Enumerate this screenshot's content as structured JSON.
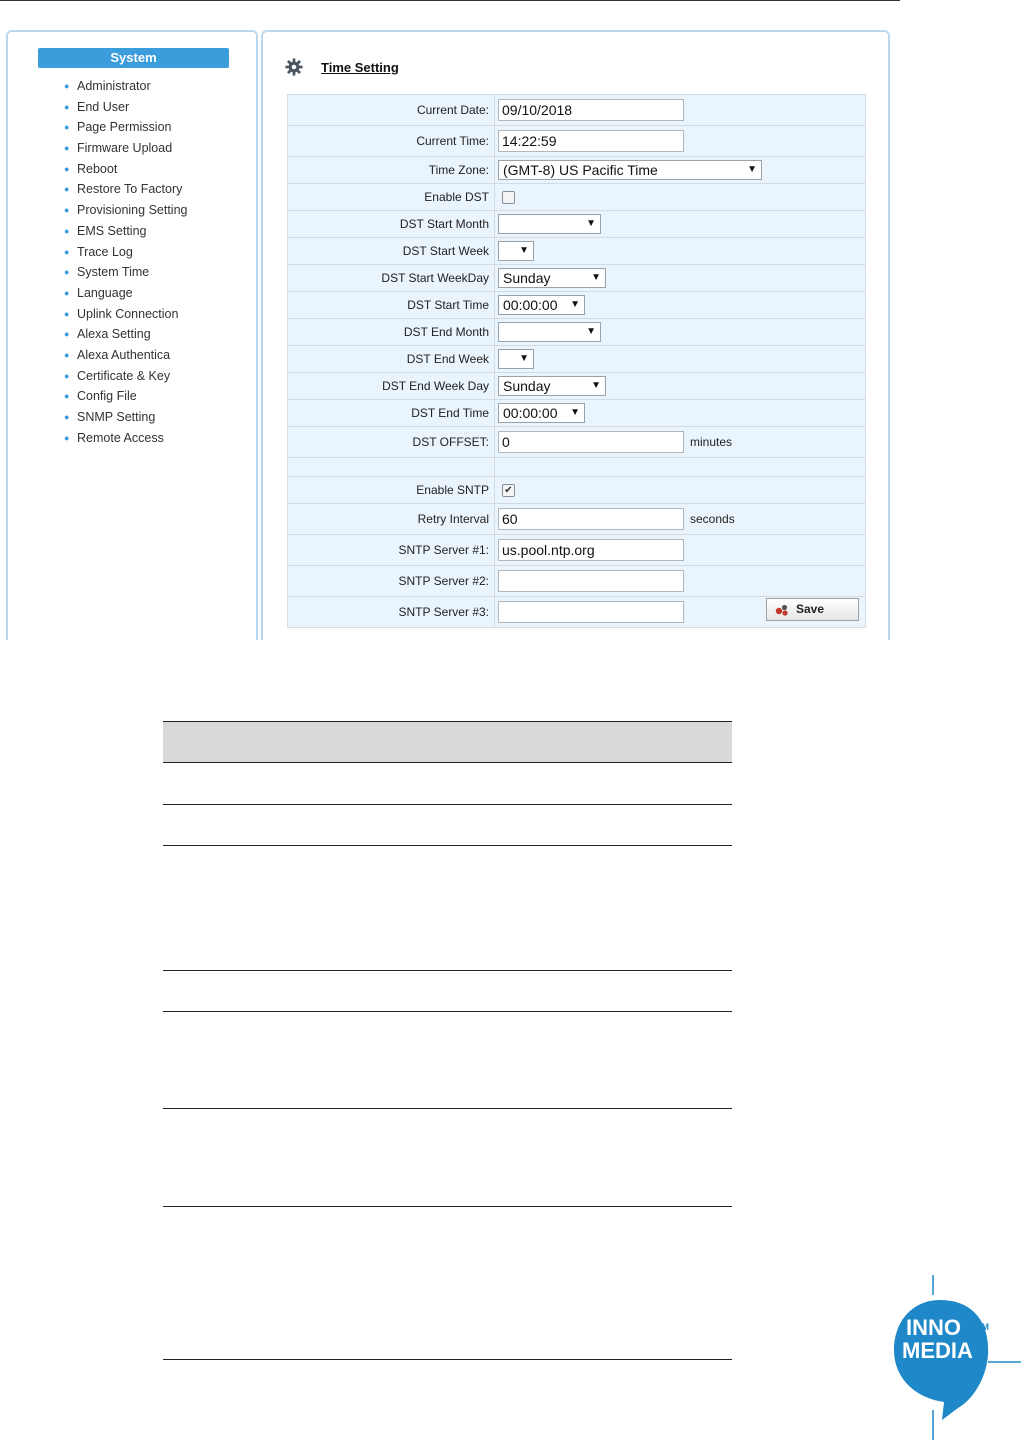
{
  "sidebar": {
    "header": "System",
    "items": [
      "Administrator",
      "End User",
      "Page Permission",
      "Firmware Upload",
      "Reboot",
      "Restore To Factory",
      "Provisioning Setting",
      "EMS Setting",
      "Trace Log",
      "System Time",
      "Language",
      "Uplink Connection",
      "Alexa Setting",
      "Alexa Authentica",
      "Certificate & Key",
      "Config File",
      "SNMP Setting",
      "Remote Access"
    ]
  },
  "page": {
    "title": "Time Setting",
    "icon": "gear-icon"
  },
  "form": {
    "current_date": {
      "label": "Current Date:",
      "value": "09/10/2018"
    },
    "current_time": {
      "label": "Current Time:",
      "value": "14:22:59"
    },
    "time_zone": {
      "label": "Time Zone:",
      "value": "(GMT-8) US Pacific Time"
    },
    "enable_dst": {
      "label": "Enable DST",
      "checked": false
    },
    "dst_start_month": {
      "label": "DST Start Month",
      "value": ""
    },
    "dst_start_week": {
      "label": "DST Start Week",
      "value": ""
    },
    "dst_start_weekday": {
      "label": "DST Start WeekDay",
      "value": "Sunday"
    },
    "dst_start_time": {
      "label": "DST Start Time",
      "value": "00:00:00"
    },
    "dst_end_month": {
      "label": "DST End Month",
      "value": ""
    },
    "dst_end_week": {
      "label": "DST End Week",
      "value": ""
    },
    "dst_end_weekday": {
      "label": "DST End Week Day",
      "value": "Sunday"
    },
    "dst_end_time": {
      "label": "DST End Time",
      "value": "00:00:00"
    },
    "dst_offset": {
      "label": "DST OFFSET:",
      "value": "0",
      "unit": "minutes"
    },
    "enable_sntp": {
      "label": "Enable SNTP",
      "checked": true
    },
    "retry_interval": {
      "label": "Retry Interval",
      "value": "60",
      "unit": "seconds"
    },
    "sntp_server_1": {
      "label": "SNTP Server #1:",
      "value": "us.pool.ntp.org"
    },
    "sntp_server_2": {
      "label": "SNTP Server #2:",
      "value": ""
    },
    "sntp_server_3": {
      "label": "SNTP Server #3:",
      "value": ""
    }
  },
  "buttons": {
    "save": "Save"
  },
  "logo": {
    "line1": "INNO",
    "line2": "MEDIA",
    "tm": "TM"
  },
  "colors": {
    "accent": "#3c9ddc",
    "panel_border": "#bcd8ee",
    "table_bg": "#eaf4fc",
    "logo_blue": "#1e88c8"
  }
}
